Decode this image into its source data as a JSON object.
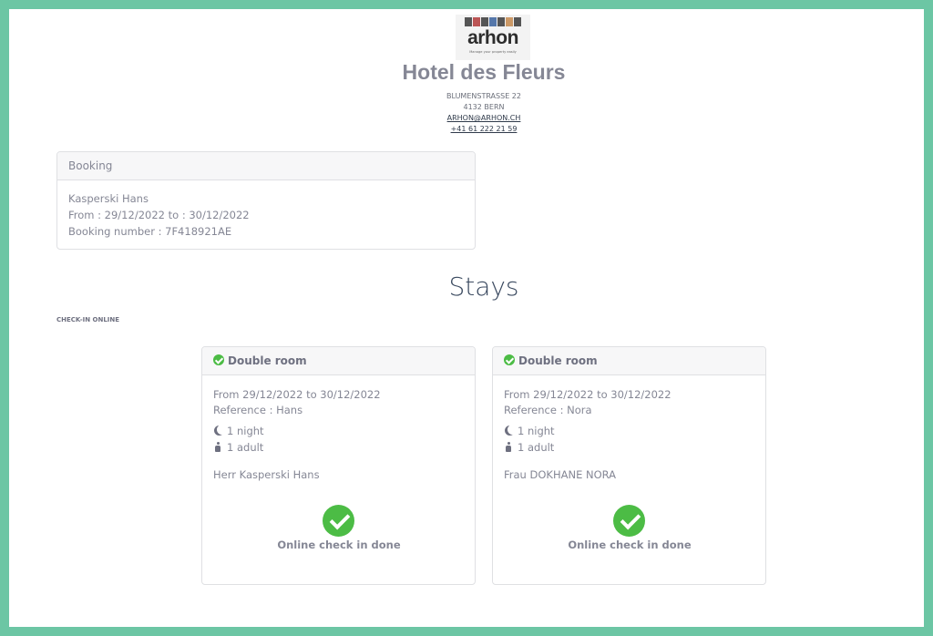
{
  "brand": {
    "logo_text": "arhon",
    "tagline": "Manage your property easily",
    "accent": "#6cc6a4"
  },
  "hotel": {
    "name": "Hotel des Fleurs",
    "street": "BLUMENSTRASSE 22",
    "city": "4132 BERN",
    "email": "ARHON@ARHON.CH",
    "phone": "+41 61 222 21 59"
  },
  "booking": {
    "header": "Booking",
    "guest": "Kasperski Hans",
    "dates": "From : 29/12/2022 to : 30/12/2022",
    "number": "Booking number : 7F418921AE"
  },
  "stays": {
    "title": "Stays",
    "checkin_label": "CHECK-IN ONLINE",
    "items": [
      {
        "room": "Double room",
        "dates": "From 29/12/2022 to 30/12/2022",
        "reference": "Reference : Hans",
        "nights": "1 night",
        "adults": "1 adult",
        "guest": "Herr Kasperski Hans",
        "status": "Online check in done"
      },
      {
        "room": "Double room",
        "dates": "From 29/12/2022 to 30/12/2022",
        "reference": "Reference : Nora",
        "nights": "1 night",
        "adults": "1 adult",
        "guest": "Frau DOKHANE NORA",
        "status": "Online check in done"
      }
    ]
  },
  "icons": {
    "status": "check-circle-icon",
    "nights": "moon-icon",
    "adults": "person-icon"
  },
  "colors": {
    "success": "#4cbc45",
    "text": "#858795",
    "heading": "#3b4a60"
  }
}
